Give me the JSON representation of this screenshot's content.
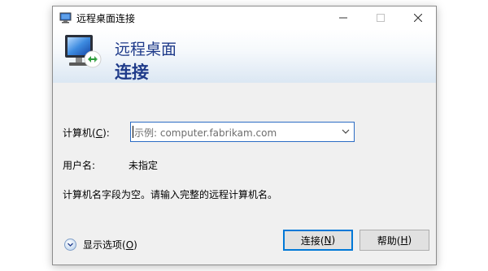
{
  "window": {
    "title": "远程桌面连接",
    "controls": {
      "minimize": "—",
      "maximize": "☐",
      "close": "✕"
    }
  },
  "banner": {
    "line1": "远程桌面",
    "line2": "连接"
  },
  "form": {
    "computer_label": "计算机(",
    "computer_accel": "C",
    "computer_label_end": "):",
    "computer_placeholder": "示例: computer.fabrikam.com",
    "user_label": "用户名:",
    "user_value": "未指定",
    "message": "计算机名字段为空。请输入完整的远程计算机名。"
  },
  "footer": {
    "show_options_prefix": "显示选项(",
    "show_options_accel": "O",
    "show_options_suffix": ")",
    "connect_prefix": "连接(",
    "connect_accel": "N",
    "connect_suffix": ")",
    "help_prefix": "帮助(",
    "help_accel": "H",
    "help_suffix": ")"
  },
  "colors": {
    "accent": "#0078d7",
    "banner_text": "#1f3b8a",
    "window_bg": "#f0f0f0"
  },
  "icons": [
    "remote-desktop-app-icon",
    "remote-desktop-monitor-icon",
    "chevron-down-icon",
    "expand-options-icon"
  ]
}
